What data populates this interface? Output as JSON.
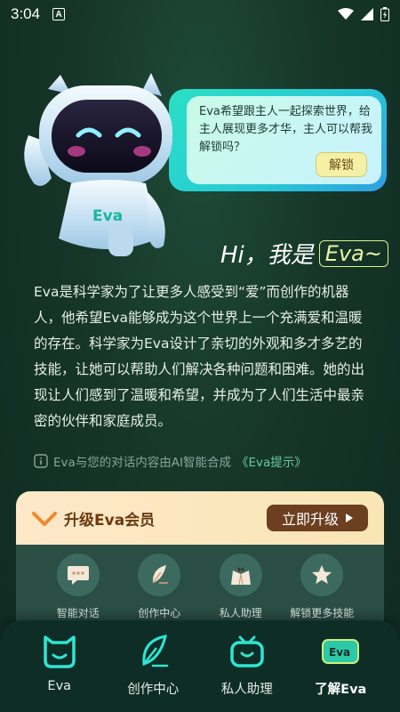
{
  "status_bar": {
    "time": "3:04",
    "indicator": "A"
  },
  "bubble": {
    "text": "Eva希望跟主人一起探索世界，给主人展现更多才华，主人可以帮我解锁吗？",
    "unlock_label": "解锁"
  },
  "heading": {
    "hi": "Hi，我是",
    "name": "Eva~"
  },
  "robot": {
    "chest_label": "Eva"
  },
  "intro": "Eva是科学家为了让更多人感受到“爱”而创作的机器人，他希望Eva能够成为这个世界上一个充满爱和温暖的存在。科学家为Eva设计了亲切的外观和多才多艺的技能，让她可以帮助人们解决各种问题和困难。她的出现让人们感到了温暖和希望，并成为了人们生活中最亲密的伙伴和家庭成员。",
  "notice": {
    "text": "Eva与您的对话内容由AI智能合成",
    "link": "《Eva提示》"
  },
  "membership": {
    "title": "升级Eva会员",
    "upgrade_label": "立即升级",
    "features": [
      {
        "label": "智能对话",
        "icon": "chat-bubble-icon"
      },
      {
        "label": "创作中心",
        "icon": "feather-pen-icon"
      },
      {
        "label": "私人助理",
        "icon": "assistant-suit-icon"
      },
      {
        "label": "解锁更多技能",
        "icon": "star-icon"
      }
    ]
  },
  "nav": {
    "items": [
      {
        "label": "Eva",
        "icon": "cat-face-icon",
        "active": false
      },
      {
        "label": "创作中心",
        "icon": "feather-pen-icon",
        "active": false
      },
      {
        "label": "私人助理",
        "icon": "tv-smile-icon",
        "active": false
      },
      {
        "label": "了解Eva",
        "icon": "eva-badge-icon",
        "active": true
      }
    ]
  },
  "colors": {
    "accent": "#2ae0c4",
    "background": "#163628",
    "member_button": "#6b3f20",
    "eva_badge": "#d9f38f"
  }
}
